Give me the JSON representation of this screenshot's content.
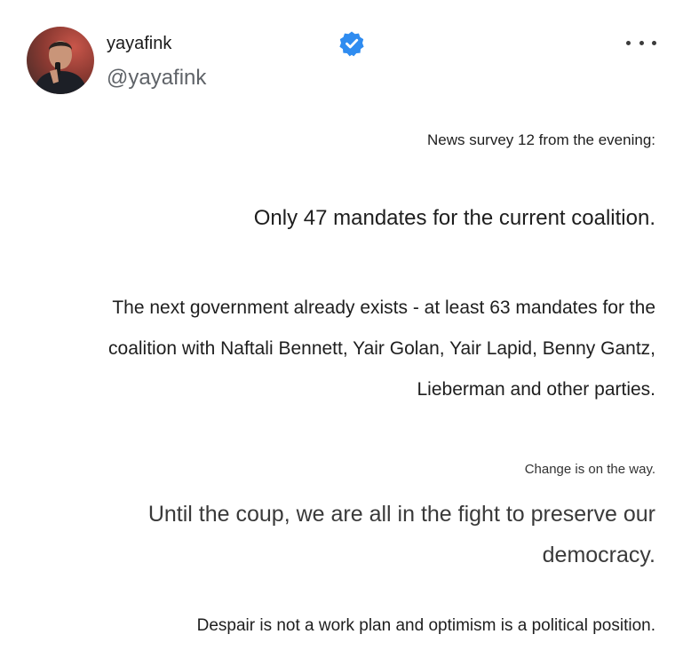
{
  "author": {
    "display_name": "yayafink",
    "handle": "@yayafink",
    "avatar_icon": "person-avatar-icon",
    "verified_icon": "verified-badge-icon",
    "verified_color": "#2f8cf0"
  },
  "menu": {
    "icon": "more-options-icon",
    "label": "•••"
  },
  "post": {
    "line1": "News survey 12 from the evening:",
    "line2": "Only 47 mandates for the current coalition.",
    "line3": "The next government already exists - at least 63 mandates for the coalition with Naftali Bennett, Yair Golan, Yair Lapid, Benny Gantz, Lieberman and other parties.",
    "line4": "Change is on the way.",
    "line5": "Until the coup, we are all in the fight to preserve our democracy.",
    "line6": "Despair is not a work plan and optimism is a political position."
  }
}
